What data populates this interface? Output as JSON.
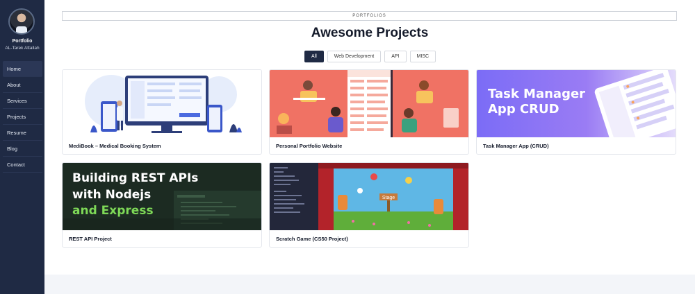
{
  "sidebar": {
    "brand": "Portfolio",
    "subtitle": "AL-Tarek Attallah",
    "items": [
      {
        "label": "Home"
      },
      {
        "label": "About"
      },
      {
        "label": "Services"
      },
      {
        "label": "Projects"
      },
      {
        "label": "Resume"
      },
      {
        "label": "Blog"
      },
      {
        "label": "Contact"
      }
    ]
  },
  "main": {
    "section_label": "PORTFOLIOS",
    "heading": "Awesome Projects",
    "filters": [
      "All",
      "Web Development",
      "API",
      "MISC"
    ],
    "projects": [
      {
        "title": "MediBook – Medical Booking System"
      },
      {
        "title": "Personal Portfolio Website"
      },
      {
        "title": "Task Manager App (CRUD)",
        "banner": "Task Manager App CRUD"
      },
      {
        "title": "REST API Project",
        "banner_line1": "Building REST APIs",
        "banner_line2": "with Nodejs",
        "banner_line3": "and Express"
      },
      {
        "title": "Scratch Game (CS50 Project)",
        "stage_label": "Stage"
      }
    ]
  },
  "colors": {
    "sidebar_bg": "#1f2a44",
    "accent": "#1f2a44",
    "portfolio_thumb_bg": "#f07264",
    "task_thumb_bg": "#7b6cf6",
    "rest_thumb_bg": "#1c2b22",
    "rest_accent": "#7ed957"
  }
}
